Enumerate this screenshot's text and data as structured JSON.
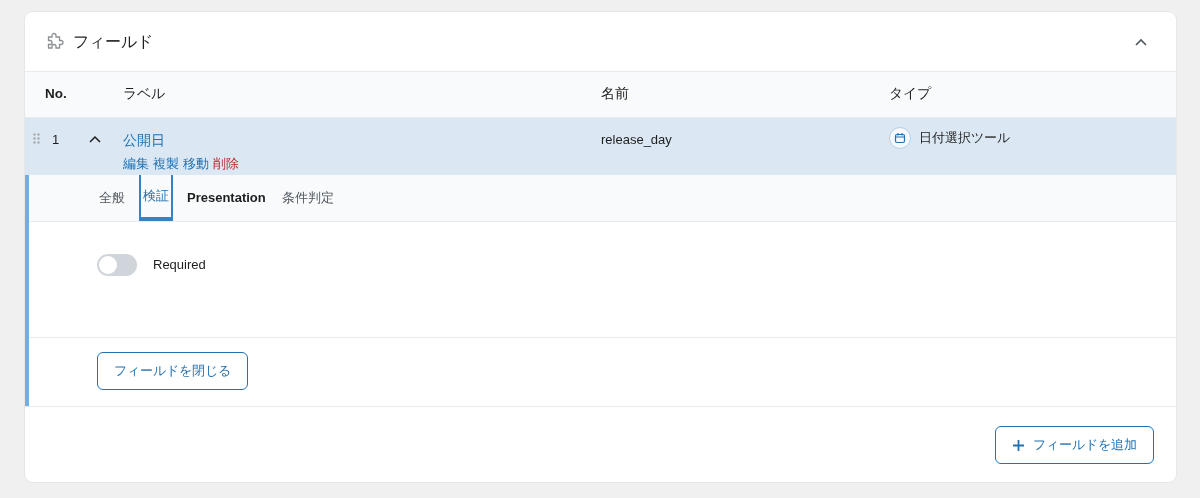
{
  "panel": {
    "title": "フィールド"
  },
  "columns": [
    "No.",
    "ラベル",
    "名前",
    "タイプ"
  ],
  "rows": [
    {
      "no": "1",
      "label": "公開日",
      "expanded": true,
      "actions": [
        {
          "text": "編集",
          "kind": "link"
        },
        {
          "text": "複製",
          "kind": "link"
        },
        {
          "text": "移動",
          "kind": "link"
        },
        {
          "text": "削除",
          "kind": "danger"
        }
      ],
      "name": "release_day",
      "type": "日付選択ツール"
    }
  ],
  "tabs": [
    {
      "label": "全般",
      "selected": false
    },
    {
      "label": "検証",
      "selected": true
    },
    {
      "label": "Presentation",
      "selected": false
    },
    {
      "label": "条件判定",
      "selected": false
    }
  ],
  "settings": [
    {
      "label": "Required",
      "on": false
    }
  ],
  "close_button": "フィールドを閉じる",
  "add_button": "フィールドを追加"
}
